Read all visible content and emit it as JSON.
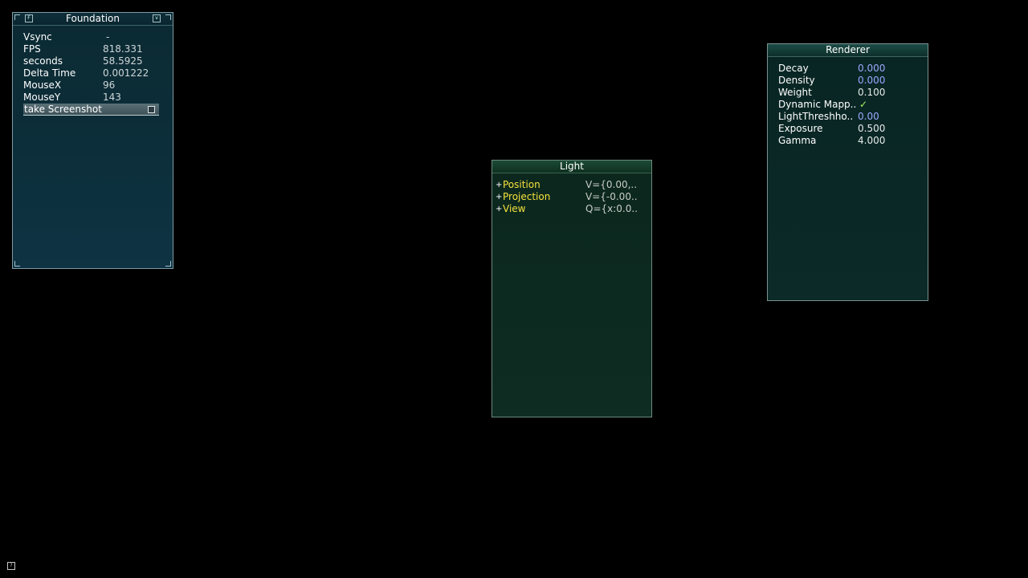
{
  "foundation": {
    "title": "Foundation",
    "rows": [
      {
        "label": "Vsync",
        "value": "-"
      },
      {
        "label": "FPS",
        "value": "818.331"
      },
      {
        "label": "seconds",
        "value": "58.5925"
      },
      {
        "label": "Delta Time",
        "value": "0.001222"
      },
      {
        "label": "MouseX",
        "value": "96"
      },
      {
        "label": "MouseY",
        "value": "143"
      }
    ],
    "screenshot_label": "take Screenshot",
    "icons": [
      "bar-menu-icon",
      "minimize-icon"
    ]
  },
  "light": {
    "title": "Light",
    "rows": [
      {
        "label": "Position",
        "value": "V={0.00,.."
      },
      {
        "label": "Projection",
        "value": "V={-0.00.."
      },
      {
        "label": "View",
        "value": "Q={x:0.0.."
      }
    ],
    "expand_glyph": "+"
  },
  "renderer": {
    "title": "Renderer",
    "rows": [
      {
        "label": "Decay",
        "value": "0.000",
        "style": "blue"
      },
      {
        "label": "Density",
        "value": "0.000",
        "style": "blue"
      },
      {
        "label": "Weight",
        "value": "0.100",
        "style": "white"
      },
      {
        "label": "Dynamic Mapp..",
        "value": "✓",
        "style": "check"
      },
      {
        "label": "LightThreshho..",
        "value": "0.00",
        "style": "blue"
      },
      {
        "label": "Exposure",
        "value": "0.500",
        "style": "white"
      },
      {
        "label": "Gamma",
        "value": "4.000",
        "style": "white"
      }
    ]
  },
  "help_icon_glyph": "?"
}
